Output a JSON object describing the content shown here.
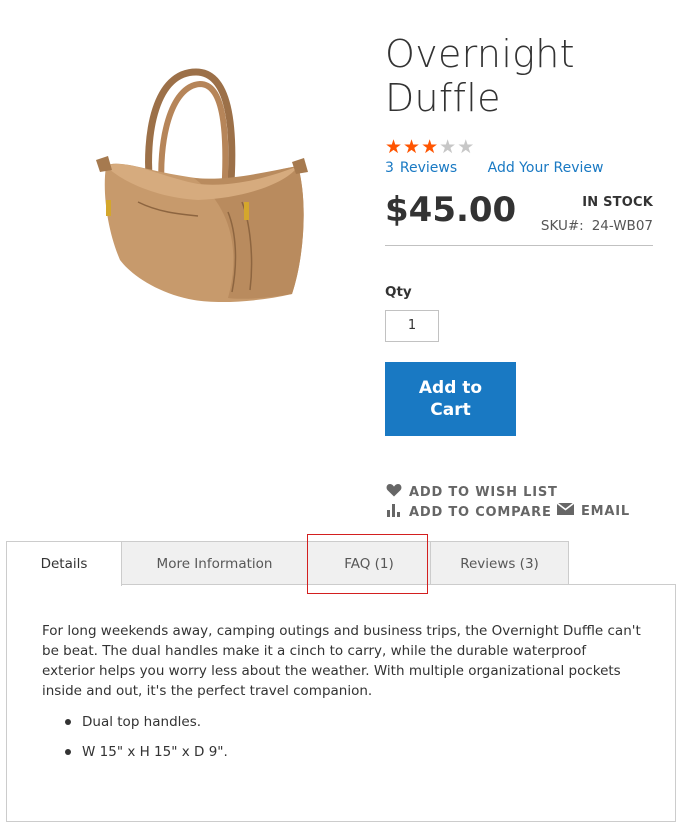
{
  "product": {
    "title_line1": "Overnight",
    "title_line2": "Duffle",
    "rating_stars": 3,
    "rating_max": 5,
    "reviews_count": "3",
    "reviews_label": "Reviews",
    "add_review_label": "Add Your Review",
    "price": "$45.00",
    "stock_status": "IN STOCK",
    "sku_label": "SKU#:",
    "sku_value": "24-WB07",
    "image_icon": "duffle-bag-image"
  },
  "purchase": {
    "qty_label": "Qty",
    "qty_value": "1",
    "add_to_cart_label": "Add to Cart"
  },
  "actions": {
    "wishlist_label": "ADD TO WISH LIST",
    "compare_label": "ADD TO COMPARE",
    "email_label": "EMAIL"
  },
  "tabs": [
    {
      "label": "Details",
      "active": true
    },
    {
      "label": "More Information",
      "active": false
    },
    {
      "label": "FAQ (1)",
      "active": false
    },
    {
      "label": "Reviews (3)",
      "active": false
    }
  ],
  "details": {
    "description": "For long weekends away, camping outings and business trips, the Overnight Duffle can't be beat. The dual handles make it a cinch to carry, while the durable waterproof exterior helps you worry less about the weather. With multiple organizational pockets inside and out, it's the perfect travel companion.",
    "features": [
      "Dual top handles.",
      "W 15\" x H 15\" x D 9\"."
    ]
  },
  "colors": {
    "accent": "#1979c3",
    "star_on": "#ff5501",
    "star_off": "#c7c7c7",
    "highlight_box": "#d31f1f"
  }
}
